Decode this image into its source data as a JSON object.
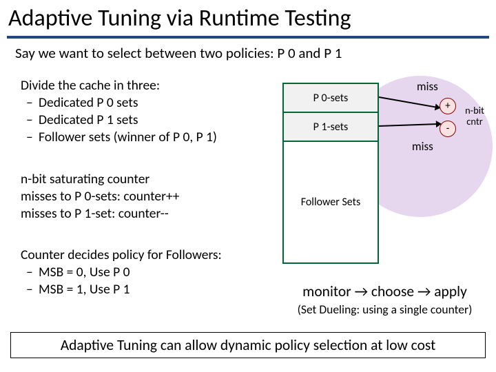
{
  "title": "Adaptive Tuning via Runtime Testing",
  "subtitle": "Say we want to select between two policies: P 0 and P 1",
  "block1": {
    "intro": "Divide the cache in three:",
    "items": [
      "Dedicated P 0 sets",
      "Dedicated P 1 sets",
      "Follower sets (winner of P 0, P 1)"
    ]
  },
  "block2": {
    "l1": "n-bit saturating counter",
    "l2": "misses to P 0-sets: counter++",
    "l3": "misses to P 1-set: counter--"
  },
  "block3": {
    "intro": "Counter decides policy for Followers:",
    "items": [
      "MSB = 0, Use P 0",
      "MSB = 1, Use P 1"
    ]
  },
  "diagram": {
    "p0": "P 0-sets",
    "p1": "P 1-sets",
    "follower": "Follower Sets",
    "miss": "miss",
    "plus": "+",
    "minus": "-",
    "cntr": "n-bit cntr"
  },
  "monitor": "monitor → choose → apply",
  "dueling": "(Set Dueling: using a single counter)",
  "footer": "Adaptive Tuning can allow dynamic policy selection at low cost"
}
